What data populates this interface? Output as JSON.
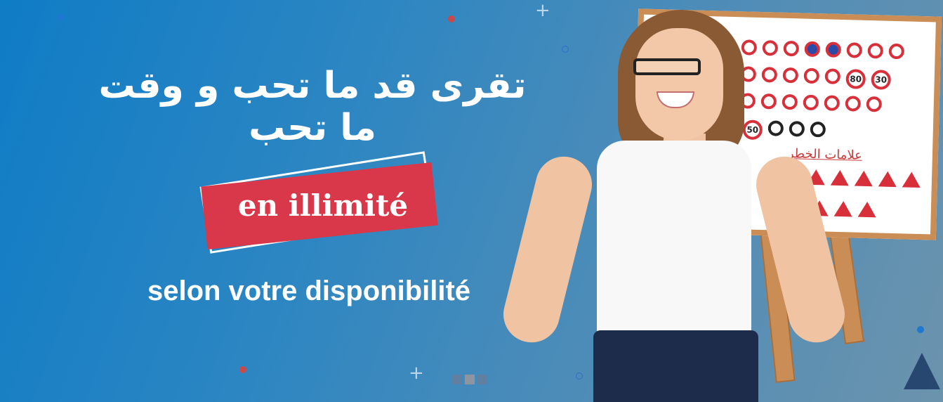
{
  "banner": {
    "arabic_title": "تقرى قد ما تحب و وقت ما تحب",
    "tag_text": "en illimité",
    "subtitle": "selon votre disponibilité",
    "board_title": "علامات الخطر",
    "speed_sign_1": "80",
    "speed_sign_2": "30",
    "speed_sign_3": "50",
    "carousel": {
      "pages": 3,
      "active_index": 1
    }
  },
  "colors": {
    "accent_red": "#d8384a",
    "background_blue": "#1f7fc0",
    "text_white": "#ffffff"
  },
  "icons": {
    "board": "road-signs-board-icon",
    "decor": [
      "plus-icon",
      "dot-icon",
      "ring-icon"
    ]
  }
}
